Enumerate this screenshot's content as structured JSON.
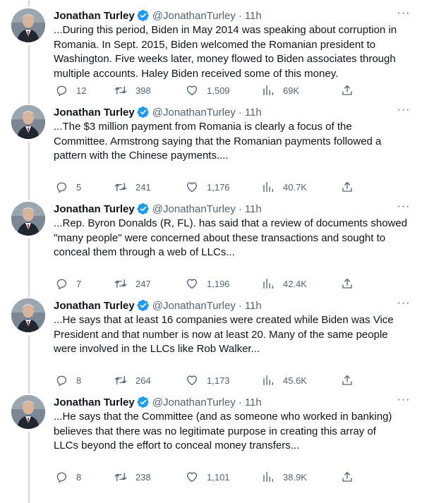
{
  "tweets": [
    {
      "name": "Jonathan Turley",
      "handle": "@JonathanTurley",
      "separator": "·",
      "time": "11h",
      "text": "...During this period, Biden in May 2014 was speaking about corruption in\nRomania. In Sept. 2015, Biden welcomed the Romanian president to\nWashington. Five weeks later, money flowed to Biden associates through\nmultiple accounts. Haley Biden received some of this money.",
      "replies": "12",
      "retweets": "398",
      "likes": "1,509",
      "views": "69K"
    },
    {
      "name": "Jonathan Turley",
      "handle": "@JonathanTurley",
      "separator": "·",
      "time": "11h",
      "text": "...The $3 million payment from Romania is clearly a focus of the\nCommittee. Armstrong saying that the Romanian payments followed a\npattern with the Chinese payments....",
      "replies": "5",
      "retweets": "241",
      "likes": "1,176",
      "views": "40.7K"
    },
    {
      "name": "Jonathan Turley",
      "handle": "@JonathanTurley",
      "separator": "·",
      "time": "11h",
      "text": "...Rep. Byron Donalds (R, FL). has said that a review of documents showed\n\"many people\" were concerned about these transactions and sought to\nconceal them through a web of LLCs...",
      "replies": "7",
      "retweets": "247",
      "likes": "1,196",
      "views": "42.4K"
    },
    {
      "name": "Jonathan Turley",
      "handle": "@JonathanTurley",
      "separator": "·",
      "time": "11h",
      "text": "...He says that at least 16 companies were created while Biden was Vice\nPresident and that number is now at least 20. Many of the same people\nwere involved in the LLCs like Rob Walker...",
      "replies": "8",
      "retweets": "264",
      "likes": "1,173",
      "views": "45.6K"
    },
    {
      "name": "Jonathan Turley",
      "handle": "@JonathanTurley",
      "separator": "·",
      "time": "11h",
      "text": "...He says that the Committee (and as someone who worked in banking)\nbelieves that there was no legitimate purpose in creating this array of\nLLCs beyond the effort to conceal money transfers...",
      "replies": "8",
      "retweets": "238",
      "likes": "1,101",
      "views": "38.9K"
    }
  ],
  "more_label": "···",
  "colors": {
    "text": "#0f1419",
    "secondary": "#536471",
    "verified": "#1d9bf0",
    "thread_line": "#cfd9de"
  },
  "icons": [
    "reply-icon",
    "retweet-icon",
    "like-icon",
    "views-icon",
    "share-icon",
    "verified-badge-icon",
    "more-icon"
  ]
}
